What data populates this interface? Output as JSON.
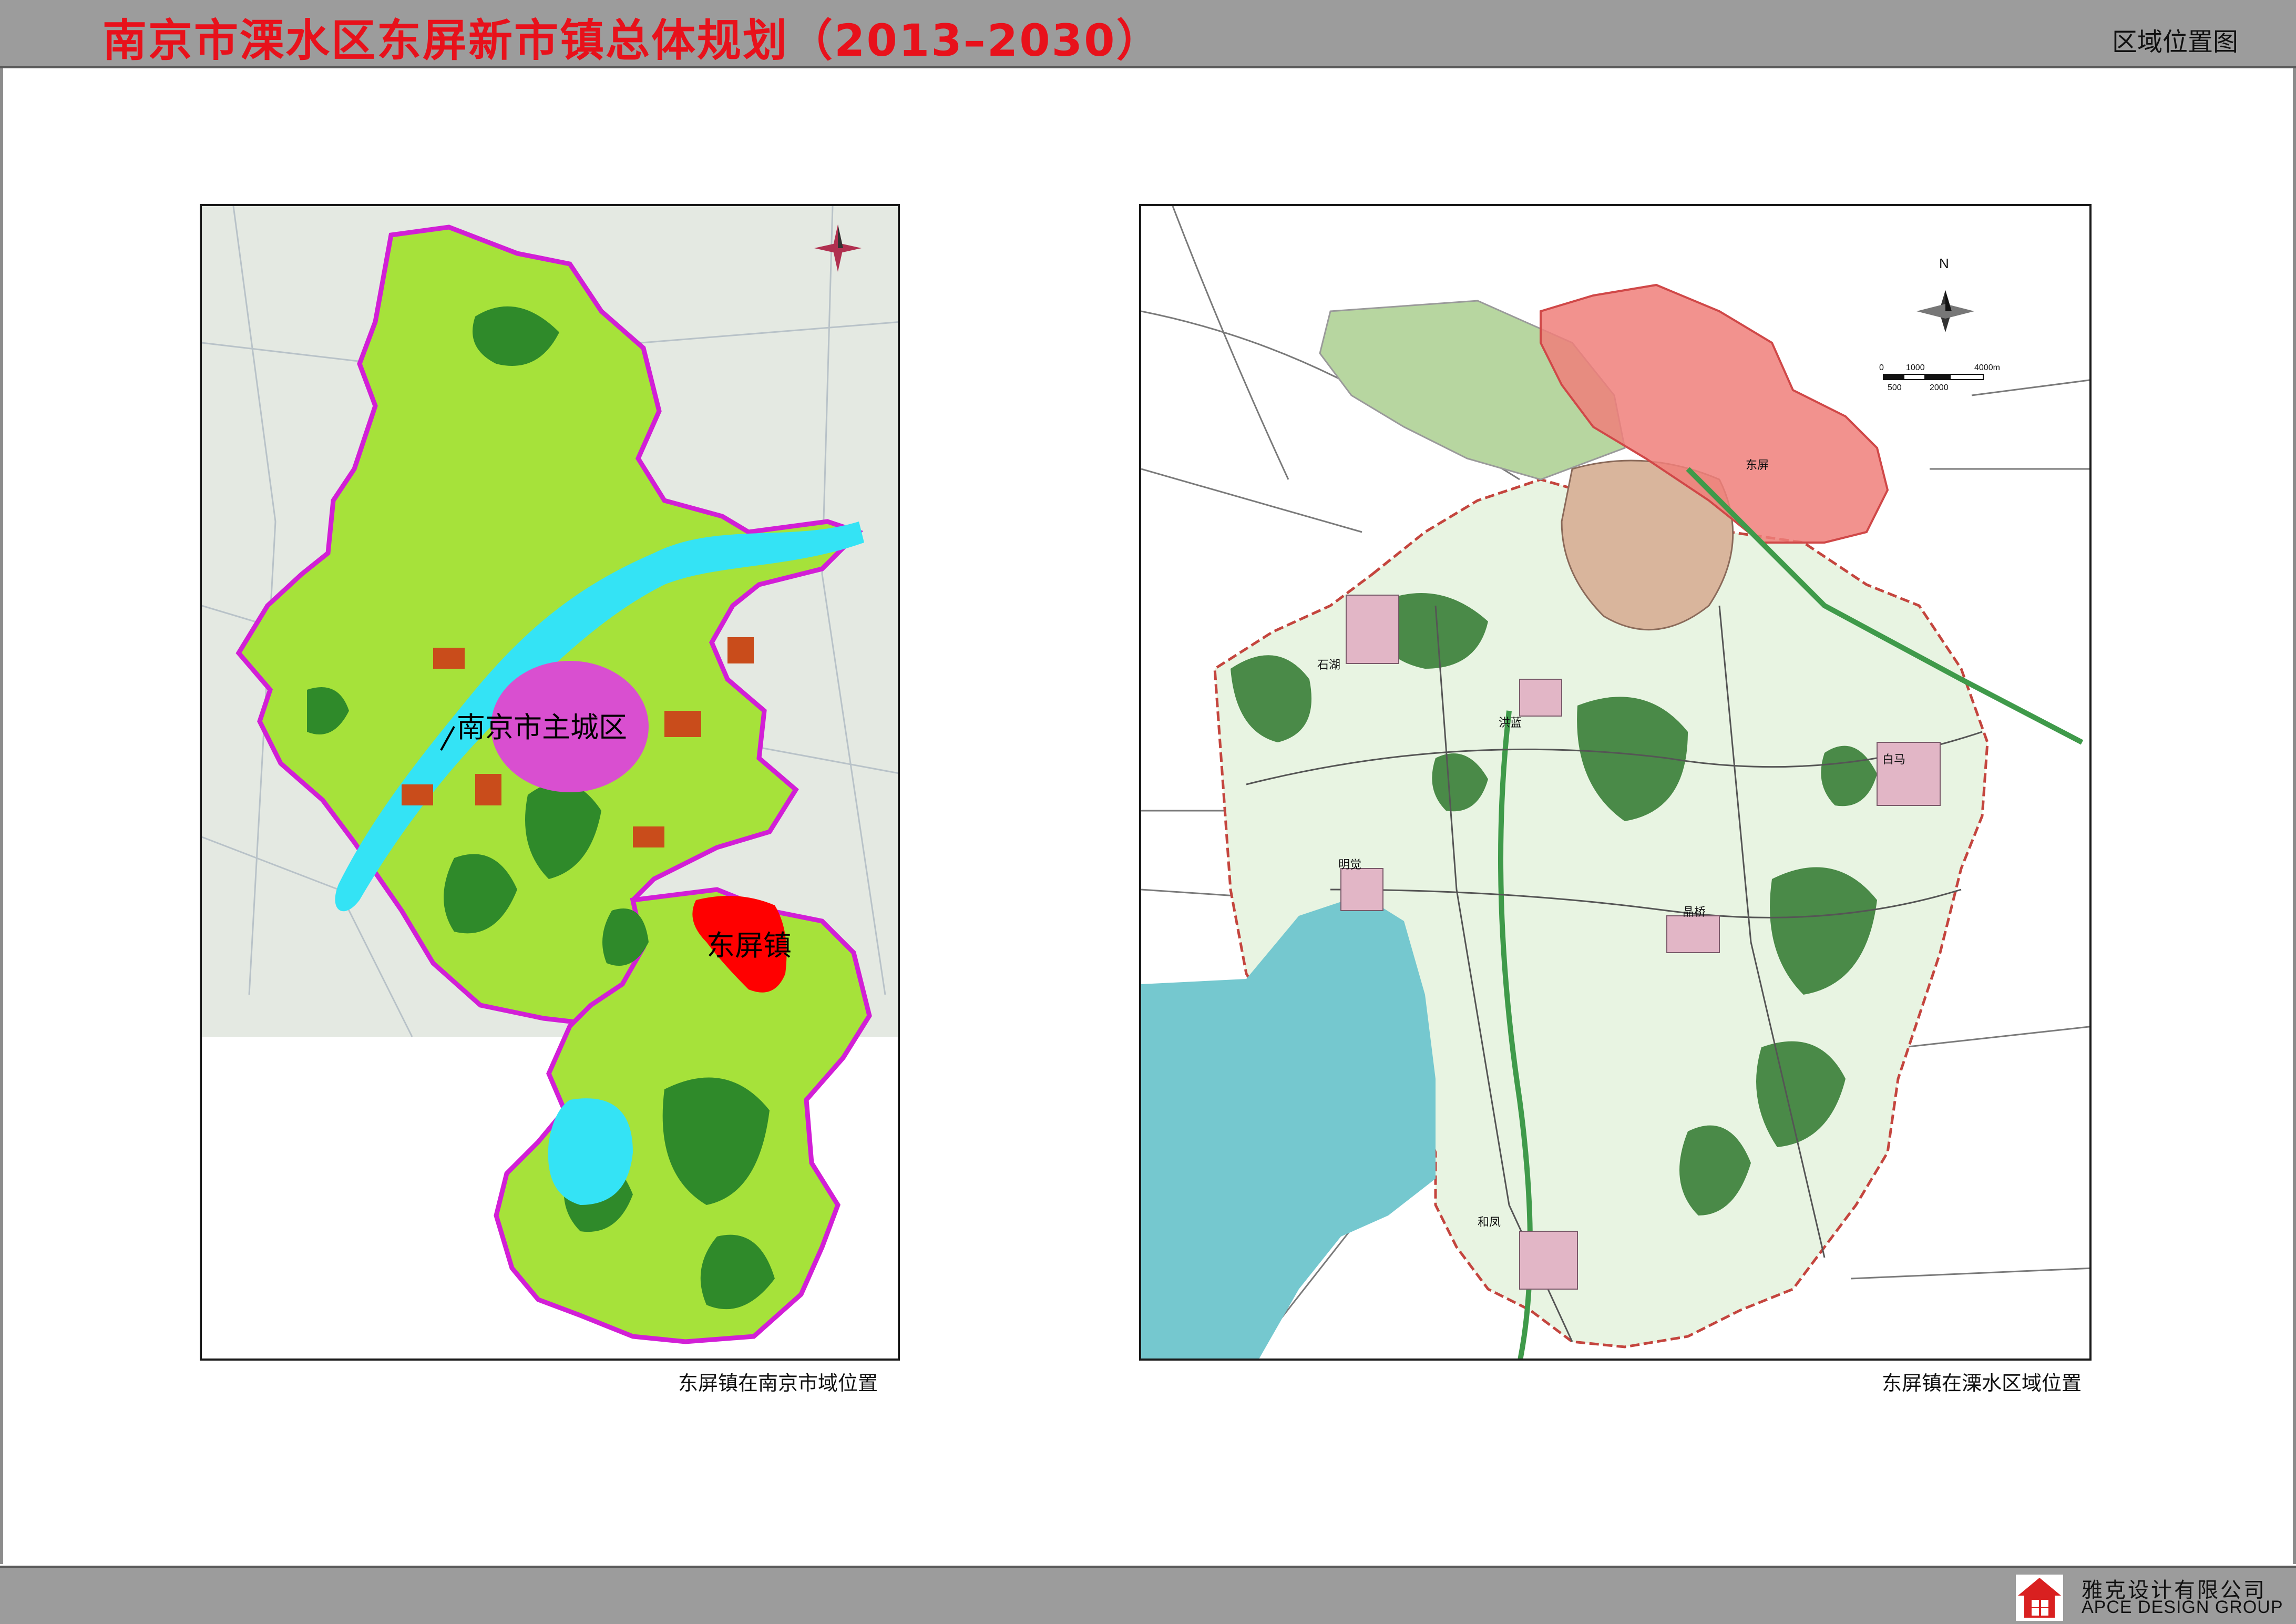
{
  "header": {
    "title": "南京市溧水区东屏新市镇总体规划（2013–2030）",
    "subtitle": "区域位置图"
  },
  "left_map": {
    "label_city": "南京市主城区",
    "label_town": "东屏镇",
    "caption": "东屏镇在南京市域位置"
  },
  "right_map": {
    "caption": "东屏镇在溧水区域位置",
    "compass": "N",
    "scale": {
      "top": [
        "0",
        "1000",
        "4000m"
      ],
      "bottom": [
        "500",
        "2000"
      ]
    },
    "places": [
      "东屏",
      "石湖",
      "洪蓝",
      "白马",
      "明觉",
      "晶桥",
      "和凤"
    ]
  },
  "footer": {
    "company_cn": "雅克设计有限公司",
    "company_en": "APCE DESIGN GROUP"
  },
  "colors": {
    "header_bg": "#9c9c9c",
    "title_red": "#e8111b",
    "land_green": "#a6e23a",
    "forest_green": "#2f8a2a",
    "water_cyan": "#34e3f5",
    "urban_pink": "#d94fd0",
    "boundary_magenta": "#d21fd6",
    "highlight_red": "#ff0000",
    "rural_pale": "#e8f4e2",
    "lake_teal": "#75c8cf",
    "dongping_pink": "#f07f7a"
  }
}
